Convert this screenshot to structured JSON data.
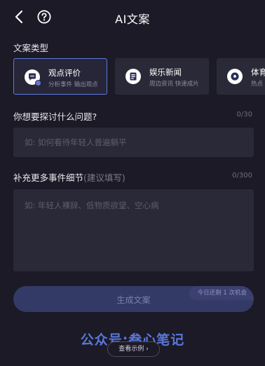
{
  "header": {
    "title": "AI文案",
    "back_icon": "chevron-left-icon",
    "help_icon": "question-circle-icon"
  },
  "section_label": "文案类型",
  "cards": [
    {
      "title": "观点评价",
      "subtitle": "分析事件 输出观点",
      "icon": "chat-bubble-icon",
      "selected": true
    },
    {
      "title": "娱乐新闻",
      "subtitle": "周边资讯 快速成片",
      "icon": "news-document-icon",
      "selected": false
    },
    {
      "title": "体育",
      "subtitle": "热点",
      "icon": "soccer-ball-icon",
      "selected": false
    }
  ],
  "question": {
    "label": "你想要探讨什么问题?",
    "count": "0/30",
    "placeholder": "如: 如何看待年轻人普遍躺平"
  },
  "detail": {
    "label": "补充更多事件细节",
    "hint": "(建议填写)",
    "count": "0/300",
    "placeholder": "如: 年轻人裸辞、低物质欲望、空心病"
  },
  "generate": {
    "label": "生成文案",
    "quota": "今日还剩 1 次机会"
  },
  "watermark": "公众号:叁心笔记",
  "example": {
    "label": "查看示例 ›"
  },
  "colors": {
    "background": "#1b1a26",
    "field": "#2a2937",
    "accent": "#5f78d8",
    "button": "#333a66"
  }
}
